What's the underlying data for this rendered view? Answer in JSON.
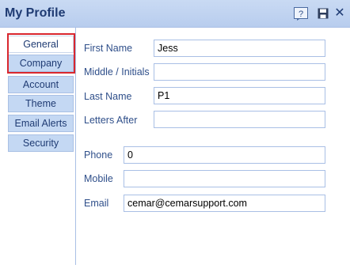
{
  "window": {
    "title": "My Profile",
    "buttons": {
      "help": "?",
      "save": "",
      "close": "✕"
    }
  },
  "sidebar": {
    "tabs": [
      {
        "label": "General"
      },
      {
        "label": "Company"
      },
      {
        "label": "Account"
      },
      {
        "label": "Theme"
      },
      {
        "label": "Email Alerts"
      },
      {
        "label": "Security"
      }
    ],
    "active_tab": "General"
  },
  "form": {
    "first_name": {
      "label": "First Name",
      "value": "Jess"
    },
    "middle_initials": {
      "label": "Middle / Initials",
      "value": ""
    },
    "last_name": {
      "label": "Last Name",
      "value": "P1"
    },
    "letters_after": {
      "label": "Letters After",
      "value": ""
    },
    "phone": {
      "label": "Phone",
      "value": "0"
    },
    "mobile": {
      "label": "Mobile",
      "value": ""
    },
    "email": {
      "label": "Email",
      "value": "cemar@cemarsupport.com"
    }
  },
  "colors": {
    "titlebar": "#c9daf3",
    "tab_bg": "#c4d8f3",
    "text": "#2f4f8a",
    "highlight": "#d9272e"
  }
}
